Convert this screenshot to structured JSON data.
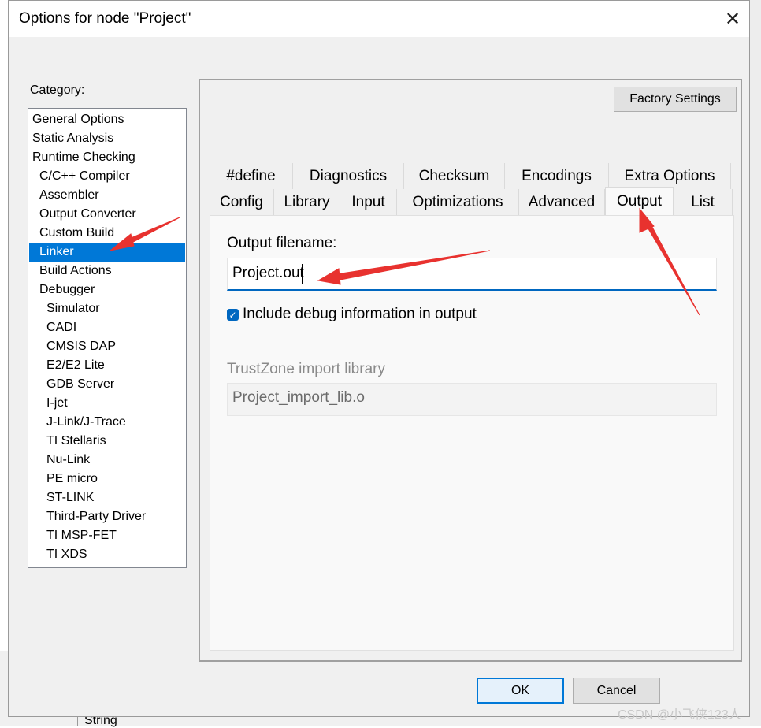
{
  "background_app": {
    "cell_text": "String"
  },
  "dialog": {
    "title": "Options for node \"Project\"",
    "close_glyph": "✕",
    "category_label": "Category:",
    "categories": [
      {
        "label": "General Options",
        "indent": 0
      },
      {
        "label": "Static Analysis",
        "indent": 0
      },
      {
        "label": "Runtime Checking",
        "indent": 0
      },
      {
        "label": "C/C++ Compiler",
        "indent": 1
      },
      {
        "label": "Assembler",
        "indent": 1
      },
      {
        "label": "Output Converter",
        "indent": 1
      },
      {
        "label": "Custom Build",
        "indent": 1
      },
      {
        "label": "Linker",
        "indent": 1,
        "selected": true
      },
      {
        "label": "Build Actions",
        "indent": 1
      },
      {
        "label": "Debugger",
        "indent": 1
      },
      {
        "label": "Simulator",
        "indent": 2
      },
      {
        "label": "CADI",
        "indent": 2
      },
      {
        "label": "CMSIS DAP",
        "indent": 2
      },
      {
        "label": "E2/E2 Lite",
        "indent": 2
      },
      {
        "label": "GDB Server",
        "indent": 2
      },
      {
        "label": "I-jet",
        "indent": 2
      },
      {
        "label": "J-Link/J-Trace",
        "indent": 2
      },
      {
        "label": "TI Stellaris",
        "indent": 2
      },
      {
        "label": "Nu-Link",
        "indent": 2
      },
      {
        "label": "PE micro",
        "indent": 2
      },
      {
        "label": "ST-LINK",
        "indent": 2
      },
      {
        "label": "Third-Party Driver",
        "indent": 2
      },
      {
        "label": "TI MSP-FET",
        "indent": 2
      },
      {
        "label": "TI XDS",
        "indent": 2
      }
    ],
    "factory_settings_label": "Factory Settings",
    "tabs_row1": [
      "#define",
      "Diagnostics",
      "Checksum",
      "Encodings",
      "Extra Options"
    ],
    "tabs_row2": [
      "Config",
      "Library",
      "Input",
      "Optimizations",
      "Advanced",
      "Output",
      "List"
    ],
    "active_tab": "Output",
    "output_filename_label": "Output filename:",
    "output_filename_value": "Project.out",
    "debug_info_label": "Include debug information in output",
    "debug_info_checked": true,
    "trustzone_label": "TrustZone import library",
    "trustzone_value": "Project_import_lib.o",
    "ok_label": "OK",
    "cancel_label": "Cancel"
  },
  "colors": {
    "selection": "#0078d7",
    "annotation_arrow": "#e8322f",
    "focus_underline": "#0067c0"
  },
  "watermark": "CSDN @小飞侠123人"
}
